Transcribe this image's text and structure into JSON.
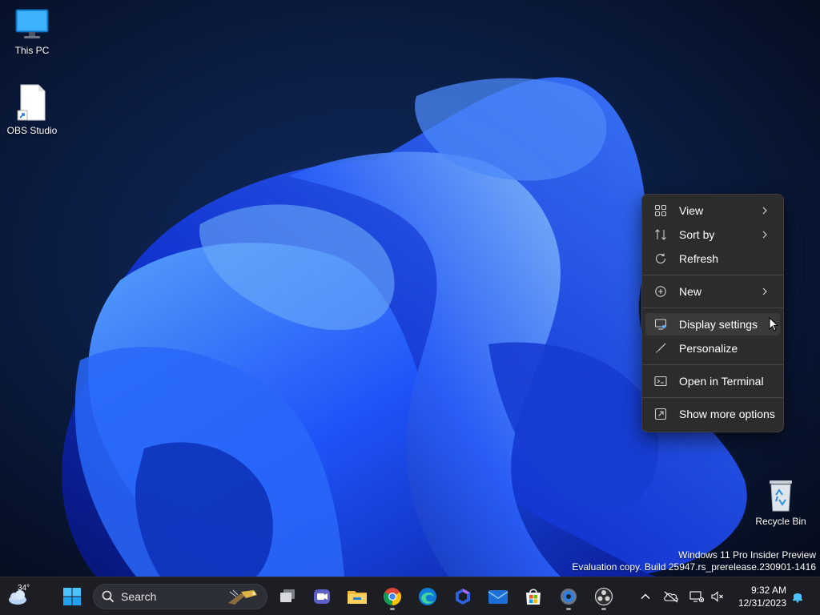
{
  "desktop": {
    "icons": [
      {
        "label": "This PC",
        "icon": "monitor"
      },
      {
        "label": "OBS Studio",
        "icon": "document-shortcut"
      },
      {
        "label": "Recycle Bin",
        "icon": "recycle-bin"
      }
    ],
    "watermark": {
      "line1": "Windows 11 Pro Insider Preview",
      "line2": "Evaluation copy. Build 25947.rs_prerelease.230901-1416"
    }
  },
  "context_menu": {
    "items": [
      {
        "label": "View",
        "icon": "grid",
        "submenu": true
      },
      {
        "label": "Sort by",
        "icon": "sort",
        "submenu": true
      },
      {
        "label": "Refresh",
        "icon": "refresh",
        "submenu": false
      },
      {
        "label": "New",
        "icon": "plus-circle",
        "submenu": true
      },
      {
        "label": "Display settings",
        "icon": "display",
        "submenu": false,
        "hovered": true
      },
      {
        "label": "Personalize",
        "icon": "brush",
        "submenu": false
      },
      {
        "label": "Open in Terminal",
        "icon": "terminal",
        "submenu": false
      },
      {
        "label": "Show more options",
        "icon": "expand",
        "submenu": false
      }
    ]
  },
  "taskbar": {
    "weather_temp": "34°",
    "search_label": "Search",
    "apps": [
      "start",
      "task-view",
      "meet",
      "file-explorer",
      "chrome",
      "edge",
      "copilot",
      "mail",
      "store",
      "settings",
      "obs"
    ],
    "clock": {
      "time": "9:32 AM",
      "date": "12/31/2023"
    }
  },
  "colors": {
    "menu_bg": "#2c2c2c",
    "taskbar_bg": "#1c1e24",
    "accent": "#1a73e8"
  }
}
